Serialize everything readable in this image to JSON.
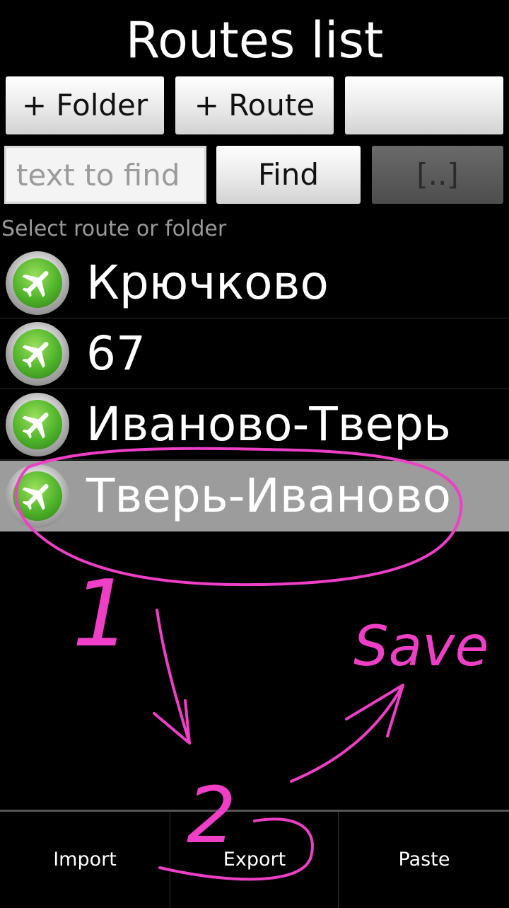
{
  "header": {
    "title": "Routes list"
  },
  "toolbar": {
    "add_folder_label": "+ Folder",
    "add_route_label": "+ Route",
    "blank_label": "",
    "find_label": "Find",
    "up_label": "[..]"
  },
  "search": {
    "placeholder": "text to find",
    "value": ""
  },
  "hint": "Select route or folder",
  "routes": [
    {
      "label": " Крючково",
      "icon": "airplane-icon"
    },
    {
      "label": "67",
      "icon": "airplane-icon"
    },
    {
      "label": "Иваново-Тверь",
      "icon": "airplane-icon"
    },
    {
      "label": "Тверь-Иваново",
      "icon": "airplane-icon",
      "selected": true
    }
  ],
  "bottom_bar": {
    "import_label": "Import",
    "export_label": "Export",
    "paste_label": "Paste"
  },
  "annotations": {
    "step1": "1",
    "step2": "2",
    "save_note": "Save",
    "color": "#ee3fc6"
  },
  "colors": {
    "background": "#000000",
    "selected_row": "#9c9c9c",
    "icon_green": "#4fb32a"
  }
}
